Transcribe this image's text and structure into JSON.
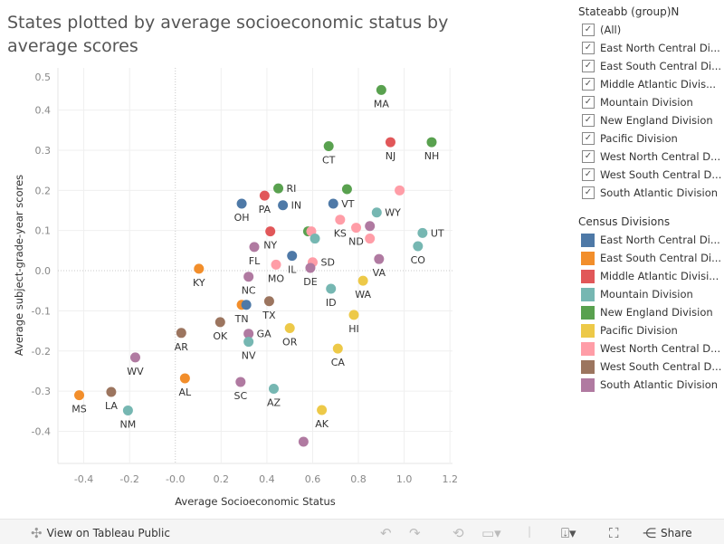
{
  "title": "States plotted by average socioeconomic status by average scores",
  "filter": {
    "header": "Stateabb (group)N",
    "items": [
      "(All)",
      "East North Central Di...",
      "East South Central Di...",
      "Middle Atlantic Divis...",
      "Mountain Division",
      "New England Division",
      "Pacific Division",
      "West North Central D...",
      "West South Central D...",
      "South Atlantic Division"
    ]
  },
  "legend": {
    "header": "Census Divisions",
    "items": [
      {
        "label": "East North Central Di...",
        "color": "#4e79a7"
      },
      {
        "label": "East South Central Di...",
        "color": "#f28e2b"
      },
      {
        "label": "Middle Atlantic Divisi...",
        "color": "#e15759"
      },
      {
        "label": "Mountain Division",
        "color": "#76b7b2"
      },
      {
        "label": "New England Division",
        "color": "#59a14f"
      },
      {
        "label": "Pacific Division",
        "color": "#edc948"
      },
      {
        "label": "West North Central D...",
        "color": "#ff9da7"
      },
      {
        "label": "West South Central D...",
        "color": "#9c755f"
      },
      {
        "label": "South Atlantic Division",
        "color": "#b07aa1"
      }
    ]
  },
  "footer": {
    "view_label": "View on Tableau Public",
    "share_label": "Share"
  },
  "chart_data": {
    "type": "scatter",
    "title": "States plotted by average socioeconomic status by average scores",
    "xlabel": "Average Socioeconomic Status",
    "ylabel": "Average subject-grade-year scores",
    "xlim": [
      -0.513,
      1.211
    ],
    "ylim": [
      -0.48,
      0.505
    ],
    "xticks": [
      "-0.4",
      "-0.2",
      "-0.0",
      "0.2",
      "0.4",
      "0.6",
      "0.8",
      "1.0",
      "1.2"
    ],
    "xtick_values": [
      -0.4,
      -0.2,
      0,
      0.2,
      0.4,
      0.6,
      0.8,
      1.0,
      1.2
    ],
    "yticks": [
      "0.5",
      "0.4",
      "0.3",
      "0.2",
      "0.1",
      "0.0",
      "-0.1",
      "-0.2",
      "-0.3",
      "-0.4"
    ],
    "ytick_values": [
      0.5,
      0.4,
      0.3,
      0.2,
      0.1,
      0,
      -0.1,
      -0.2,
      -0.3,
      -0.4
    ],
    "grid": true,
    "points": [
      {
        "label": "MA",
        "division": 4,
        "x": 0.9,
        "y": 0.45
      },
      {
        "label": "NJ",
        "division": 2,
        "x": 0.94,
        "y": 0.32
      },
      {
        "label": "NH",
        "division": 4,
        "x": 1.12,
        "y": 0.32
      },
      {
        "label": "CT",
        "division": 4,
        "x": 0.67,
        "y": 0.31
      },
      {
        "label": "RI",
        "division": 4,
        "x": 0.45,
        "y": 0.205
      },
      {
        "label": "",
        "division": 4,
        "x": 0.75,
        "y": 0.203
      },
      {
        "label": "",
        "division": 6,
        "x": 0.98,
        "y": 0.2
      },
      {
        "label": "OH",
        "division": 0,
        "x": 0.29,
        "y": 0.167
      },
      {
        "label": "PA",
        "division": 2,
        "x": 0.39,
        "y": 0.187
      },
      {
        "label": "IN",
        "division": 0,
        "x": 0.47,
        "y": 0.163
      },
      {
        "label": "VT",
        "division": 0,
        "x": 0.69,
        "y": 0.167
      },
      {
        "label": "WY",
        "division": 3,
        "x": 0.88,
        "y": 0.145
      },
      {
        "label": "KS",
        "division": 6,
        "x": 0.72,
        "y": 0.127
      },
      {
        "label": "ND",
        "division": 6,
        "x": 0.79,
        "y": 0.107
      },
      {
        "label": "",
        "division": 8,
        "x": 0.85,
        "y": 0.111
      },
      {
        "label": "UT",
        "division": 3,
        "x": 1.08,
        "y": 0.094
      },
      {
        "label": "NY",
        "division": 2,
        "x": 0.415,
        "y": 0.098
      },
      {
        "label": "",
        "division": 4,
        "x": 0.58,
        "y": 0.098
      },
      {
        "label": "",
        "division": 6,
        "x": 0.594,
        "y": 0.098
      },
      {
        "label": "",
        "division": 3,
        "x": 0.61,
        "y": 0.08
      },
      {
        "label": "",
        "division": 6,
        "x": 0.85,
        "y": 0.08
      },
      {
        "label": "FL",
        "division": 8,
        "x": 0.345,
        "y": 0.059
      },
      {
        "label": "VA",
        "division": 8,
        "x": 0.89,
        "y": 0.029
      },
      {
        "label": "CO",
        "division": 3,
        "x": 1.06,
        "y": 0.061
      },
      {
        "label": "IL",
        "division": 0,
        "x": 0.51,
        "y": 0.037
      },
      {
        "label": "MO",
        "division": 6,
        "x": 0.44,
        "y": 0.015
      },
      {
        "label": "SD",
        "division": 6,
        "x": 0.6,
        "y": 0.021
      },
      {
        "label": "DE",
        "division": 8,
        "x": 0.59,
        "y": 0.007
      },
      {
        "label": "KY",
        "division": 1,
        "x": 0.103,
        "y": 0.005
      },
      {
        "label": "NC",
        "division": 8,
        "x": 0.32,
        "y": -0.015
      },
      {
        "label": "WA",
        "division": 5,
        "x": 0.82,
        "y": -0.025
      },
      {
        "label": "ID",
        "division": 3,
        "x": 0.68,
        "y": -0.045
      },
      {
        "label": "TN",
        "division": 1,
        "x": 0.29,
        "y": -0.085
      },
      {
        "label": "",
        "division": 0,
        "x": 0.31,
        "y": -0.085
      },
      {
        "label": "TX",
        "division": 7,
        "x": 0.41,
        "y": -0.076
      },
      {
        "label": "HI",
        "division": 5,
        "x": 0.78,
        "y": -0.11
      },
      {
        "label": "OR",
        "division": 5,
        "x": 0.5,
        "y": -0.143
      },
      {
        "label": "GA",
        "division": 8,
        "x": 0.32,
        "y": -0.157
      },
      {
        "label": "NV",
        "division": 3,
        "x": 0.32,
        "y": -0.177
      },
      {
        "label": "CA",
        "division": 5,
        "x": 0.71,
        "y": -0.194
      },
      {
        "label": "SC",
        "division": 8,
        "x": 0.285,
        "y": -0.277
      },
      {
        "label": "AZ",
        "division": 3,
        "x": 0.43,
        "y": -0.294
      },
      {
        "label": "AK",
        "division": 5,
        "x": 0.64,
        "y": -0.347
      },
      {
        "label": "",
        "division": 8,
        "x": 0.56,
        "y": -0.426
      },
      {
        "label": "OK",
        "division": 7,
        "x": 0.196,
        "y": -0.128
      },
      {
        "label": "AR",
        "division": 7,
        "x": 0.026,
        "y": -0.155
      },
      {
        "label": "AL",
        "division": 1,
        "x": 0.042,
        "y": -0.268
      },
      {
        "label": "WV",
        "division": 8,
        "x": -0.175,
        "y": -0.216
      },
      {
        "label": "MS",
        "division": 1,
        "x": -0.42,
        "y": -0.31
      },
      {
        "label": "LA",
        "division": 7,
        "x": -0.28,
        "y": -0.302
      },
      {
        "label": "NM",
        "division": 3,
        "x": -0.207,
        "y": -0.348
      }
    ]
  }
}
